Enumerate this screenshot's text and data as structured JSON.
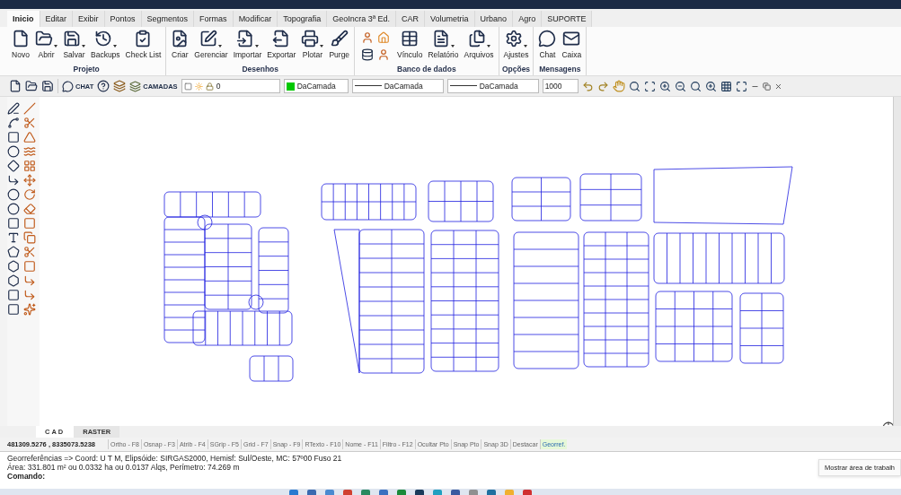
{
  "tabs": [
    {
      "label": "Inicio",
      "selected": true
    },
    {
      "label": "Editar",
      "selected": false
    },
    {
      "label": "Exibir",
      "selected": false
    },
    {
      "label": "Pontos",
      "selected": false
    },
    {
      "label": "Segmentos",
      "selected": false
    },
    {
      "label": "Formas",
      "selected": false
    },
    {
      "label": "Modificar",
      "selected": false
    },
    {
      "label": "Topografia",
      "selected": false
    },
    {
      "label": "GeoIncra 3ª Ed.",
      "selected": false
    },
    {
      "label": "CAR",
      "selected": false
    },
    {
      "label": "Volumetria",
      "selected": false
    },
    {
      "label": "Urbano",
      "selected": false
    },
    {
      "label": "Agro",
      "selected": false
    },
    {
      "label": "SUPORTE",
      "selected": false
    }
  ],
  "ribbon_groups": [
    {
      "title": "Projeto",
      "icon_cluster": false,
      "buttons": [
        {
          "label": "Novo",
          "dropdown": false
        },
        {
          "label": "Abrir",
          "dropdown": true
        },
        {
          "label": "Salvar",
          "dropdown": true
        },
        {
          "label": "Backups",
          "dropdown": true
        },
        {
          "label": "Check List",
          "dropdown": false
        }
      ]
    },
    {
      "title": "Desenhos",
      "icon_cluster": false,
      "buttons": [
        {
          "label": "Criar",
          "dropdown": false
        },
        {
          "label": "Gerenciar",
          "dropdown": true
        },
        {
          "label": "Importar",
          "dropdown": true
        },
        {
          "label": "Exportar",
          "dropdown": false
        },
        {
          "label": "Plotar",
          "dropdown": true
        },
        {
          "label": "Purge",
          "dropdown": false
        }
      ]
    },
    {
      "title": "Banco de dados",
      "icon_cluster": true,
      "buttons": [
        {
          "label": "Vínculo",
          "dropdown": false
        },
        {
          "label": "Relatório",
          "dropdown": true
        },
        {
          "label": "Arquivos",
          "dropdown": true
        }
      ]
    },
    {
      "title": "Opções",
      "icon_cluster": false,
      "buttons": [
        {
          "label": "Ajustes",
          "dropdown": true
        }
      ]
    },
    {
      "title": "Mensagens",
      "icon_cluster": false,
      "buttons": [
        {
          "label": "Chat",
          "dropdown": false
        },
        {
          "label": "Caixa",
          "dropdown": false
        }
      ]
    }
  ],
  "toolbar": {
    "chat_label": "CHAT",
    "layers_label": "CAMADAS",
    "selects": [
      {
        "kind": "layer",
        "value": "0"
      },
      {
        "kind": "color",
        "value": "DaCamada"
      },
      {
        "kind": "linetype",
        "value": "DaCamada"
      },
      {
        "kind": "linetype",
        "value": "DaCamada"
      },
      {
        "kind": "scale",
        "value": "1000"
      }
    ]
  },
  "bottom_tabs": [
    {
      "label": "CAD",
      "selected": true
    },
    {
      "label": "RASTER",
      "selected": false
    }
  ],
  "status_bar": {
    "coordinates": "481309.5276 , 8335073.5238",
    "toggles": [
      {
        "label": "Ortho - F8",
        "on": false
      },
      {
        "label": "Osnap - F3",
        "on": false
      },
      {
        "label": "Atrib - F4",
        "on": false
      },
      {
        "label": "SGrip - F5",
        "on": false
      },
      {
        "label": "Grid - F7",
        "on": false
      },
      {
        "label": "Snap - F9",
        "on": false
      },
      {
        "label": "RTexto - F10",
        "on": false
      },
      {
        "label": "Nome - F11",
        "on": false
      },
      {
        "label": "Filtro - F12",
        "on": false
      },
      {
        "label": "Ocultar Pto",
        "on": false
      },
      {
        "label": "Snap Pto",
        "on": false
      },
      {
        "label": "Snap 3D",
        "on": false
      },
      {
        "label": "Destacar",
        "on": false
      },
      {
        "label": "Georref.",
        "on": true
      }
    ]
  },
  "command_area": {
    "lines": [
      "Georreferências => Coord: U T M, Elipsóide: SIRGAS2000, Hemisf: Sul/Oeste, MC: 57º00 Fuso 21",
      "Área: 331.801 m² ou 0.0332 ha ou 0.0137 Alqs, Perímetro: 74.269 m"
    ],
    "prompt": "Comando:"
  },
  "tooltip": "Mostrar área de trabalh"
}
